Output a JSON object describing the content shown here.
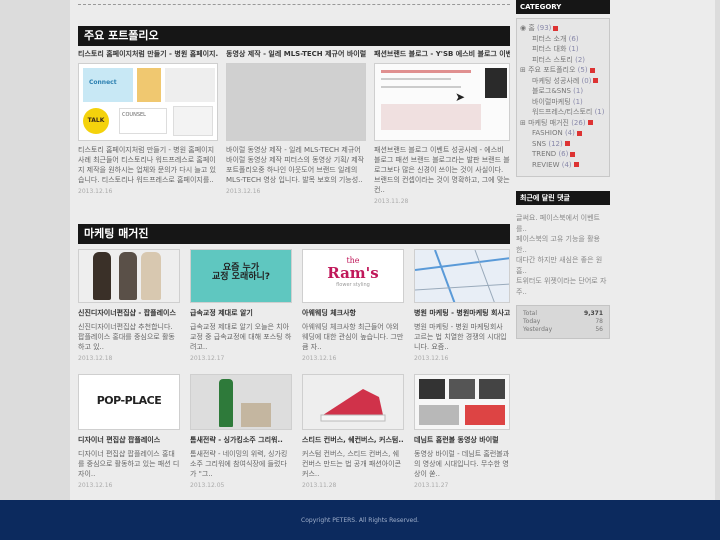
{
  "portfolio": {
    "heading": "주요 포트폴리오",
    "items": [
      {
        "title": "티스토리 홈페이지처럼 만들기 - 병원 홈페이지..",
        "desc": "티스토리 홈페이지처럼 만들기 - 병원 홈페이지 사례 최근들어 티스토리나 워드프레스로 홈페이지 제작을 원하시는 업체와 문의가 다시 늘고 있습니다. 티스토리나 워드프레스로 홈페이지를..",
        "date": "2013.12.16",
        "thumb_labels": [
          "Connect",
          "TALK",
          "COUNSEL"
        ]
      },
      {
        "title": "동영상 제작 - 일레 MLS-TECH 제규어 바이럴..",
        "desc": "바이럴 동영상 제작 - 일레 MLS-TECH 제규어 바이럴 동영상 제작 피터스의 동영상 기획/ 제작 포트폴리오중 하나인 아웃도어 브랜드 일레의 MLS-TECH 영상 입니다. 발목 보호의 기능성..",
        "date": "2013.12.16"
      },
      {
        "title": "패션브랜드 블로그 - Y'SB 에스비 블로그 이벤..",
        "desc": "패션브랜드 블로그 이벤트 성공사례 - 에스비 블로그 패션 브랜드 블로그라는 발판 브랜드 블로그보다 많은 신경이 쓰이는 것이 사실이다. 브랜드의 컨셉이라는 것이 명확하고, 그에 맞는 컨..",
        "date": "2013.11.28"
      }
    ]
  },
  "marketing": {
    "heading": "마케팅 매거진",
    "items": [
      {
        "title": "신진디자이너편집샵 - 팝플레이스",
        "desc": "신진디자이너편집샵 추천합니다. 팝플레이스 홍대를 중심으로 활동하고 있..",
        "date": "2013.12.18"
      },
      {
        "title": "급속교정 제대로 알기",
        "desc": "급속교정 제대로 알기 오늘은 치아교정 중 급속교정에 대해 포스팅 하려고..",
        "date": "2013.12.17",
        "thumb_text_1": "요즘 누가",
        "thumb_text_2": "교정 오래하니?"
      },
      {
        "title": "아웨웨딩 체크사항",
        "desc": "아웨웨딩 체크사항 최근들어 야외웨딩에 대한 관심이 높습니다. 그만큼 자..",
        "date": "2013.12.16",
        "thumb_text_1": "the",
        "thumb_text_2": "Ram's",
        "thumb_text_3": "flower styling"
      },
      {
        "title": "병원 마케팅 - 병원마케팅 회사고..",
        "desc": "병원 마케팅 - 병원 마케팅회사 고르는 법 치열한 경쟁의 시대입니다. 요즘..",
        "date": "2013.12.16"
      },
      {
        "title": "디자이너 편집샵 팝플레이스",
        "desc": "디자이너 편집샵 팝플레이스 홍대를 중심으로 활동하고 있는 패션 디자이..",
        "date": "2013.12.16",
        "thumb_text_1": "POP-PLACE"
      },
      {
        "title": "톰새전략 - 싱가킹소주 그리워..",
        "desc": "톰새전략 - 네이밍의 위력, 싱가킹 소주 그리워에 참여식장에 들렀다가 \"그..",
        "date": "2013.12.05"
      },
      {
        "title": "스티드 컨버스, 쉐컨버스, 커스텀..",
        "desc": "커스텀 컨버스, 스티드 컨버스, 쉐컨버스 만드는 법 공개 패션아이콘 커스..",
        "date": "2013.11.28"
      },
      {
        "title": "데님트 홈런볼 동영상 바이럴",
        "desc": "동영상 바이럴 - 데님트 홈런볼과의 영상에 시대입니다. 무수한 영상이 쏟..",
        "date": "2013.11.27"
      }
    ]
  },
  "sidebar": {
    "category_heading": "CATEGORY",
    "categories": [
      {
        "label": "홈",
        "count": "(93)"
      },
      {
        "label": "피터스 소개",
        "count": "(6)"
      },
      {
        "label": "피터스 대화",
        "count": "(1)"
      },
      {
        "label": "피터스 스토리",
        "count": "(2)"
      },
      {
        "label": "주요 포트폴리오",
        "count": "(5)"
      },
      {
        "label": "마케팅 성공사례",
        "count": "(0)"
      },
      {
        "label": "블로그&SNS",
        "count": "(1)"
      },
      {
        "label": "바이럴마케팅",
        "count": "(1)"
      },
      {
        "label": "워드프레스/티스토리",
        "count": "(1)"
      },
      {
        "label": "마케팅 매거진",
        "count": "(26)"
      },
      {
        "label": "FASHION",
        "count": "(4)"
      },
      {
        "label": "SNS",
        "count": "(12)"
      },
      {
        "label": "TREND",
        "count": "(6)"
      },
      {
        "label": "REVIEW",
        "count": "(4)"
      }
    ],
    "recent_heading": "최근에 달린 댓글",
    "recent_comments": [
      "글써요. 페이스북에서 이벤트를..",
      "페이스북의 고유 기능을 활용한..",
      "대다간 하지만 새심은 좋은 원",
      "흠..",
      "트위터도 위젯이라는 단어로 자주.."
    ],
    "stats": [
      {
        "label": "Total",
        "value": "9,371"
      },
      {
        "label": "Today",
        "value": "78"
      },
      {
        "label": "Yesterday",
        "value": "56"
      }
    ]
  },
  "footer": {
    "copyright": "Copyright PETERS. All Rights Reserved."
  },
  "colors": {
    "header_bg": "#161616",
    "footer_bg": "#0c2a5e",
    "badge": "#d33333"
  }
}
